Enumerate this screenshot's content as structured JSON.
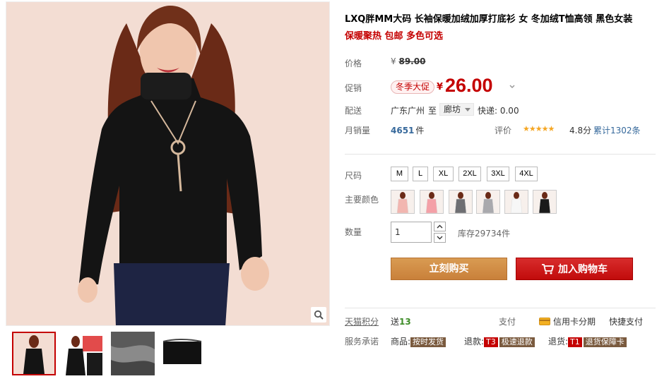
{
  "product": {
    "title": "LXQ胖MM大码 长袖保暖加绒加厚打底衫 女 冬加绒T恤高领 黑色女装",
    "subtitle": "保暖聚热 包邮 多色可选"
  },
  "pricing": {
    "price_label": "价格",
    "currency": "¥",
    "original_price": "89.00",
    "promo_label": "促销",
    "promo_badge": "冬季大促",
    "promo_price": "26.00"
  },
  "shipping": {
    "label": "配送",
    "from": "广东广州",
    "to_word": "至",
    "destination": "廊坊",
    "express": "快递: 0.00"
  },
  "sales": {
    "label": "月销量",
    "count": "4651",
    "unit": "件",
    "rating_label": "评价",
    "stars": "★★★★★",
    "rating_value": "4.8",
    "rating_unit": "分",
    "review_count": "累计1302条"
  },
  "size": {
    "label": "尺码",
    "options": [
      "M",
      "L",
      "XL",
      "2XL",
      "3XL",
      "4XL"
    ]
  },
  "color": {
    "label": "主要颜色",
    "options": [
      {
        "swatch": "#f2b6b0"
      },
      {
        "swatch": "#f4a0a7"
      },
      {
        "swatch": "#6e6e72"
      },
      {
        "swatch": "#a9a9ad"
      },
      {
        "swatch": "#f7f7f7"
      },
      {
        "swatch": "#1a1a1a"
      }
    ]
  },
  "quantity": {
    "label": "数量",
    "value": "1",
    "stock": "库存29734件"
  },
  "actions": {
    "buy_now": "立刻购买",
    "add_to_cart": "加入购物车"
  },
  "footer": {
    "points_label": "天猫积分",
    "points_prefix": "送",
    "points_value": "13",
    "pay_label": "支付",
    "credit_installment": "信用卡分期",
    "quick_pay": "快捷支付",
    "promise_label": "服务承诺",
    "goods_prefix": "商品:",
    "goods_tag": "按时发货",
    "refund_prefix": "退款:",
    "refund_code": "T3",
    "refund_tag": "极速退款",
    "return_prefix": "退货:",
    "return_code": "T1",
    "return_tag": "退货保障卡"
  },
  "colors": {
    "accent_red": "#c40000",
    "buy_orange": "#cf8a45",
    "cart_red": "#c80d0d",
    "link_blue": "#35689b",
    "star_gold": "#f5a623"
  }
}
